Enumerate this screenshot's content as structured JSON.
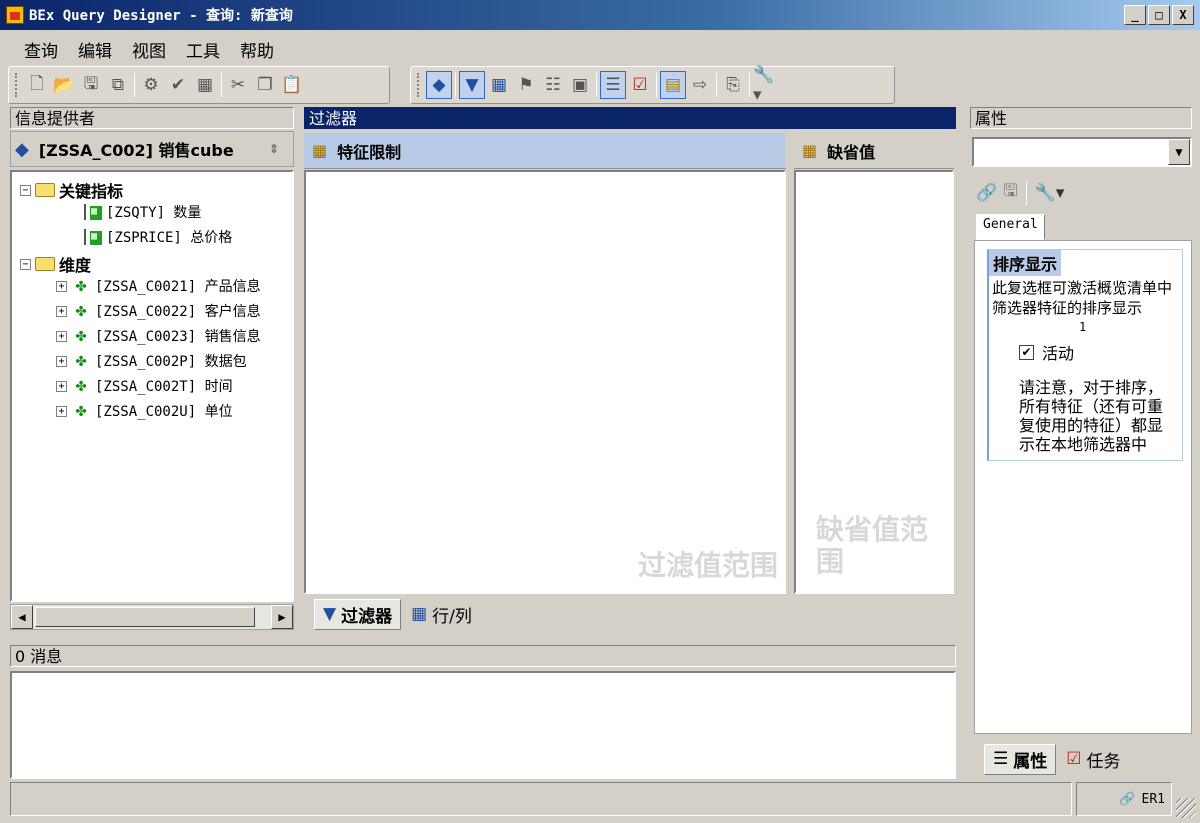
{
  "window": {
    "title": "BEx Query Designer - 查询: 新查询",
    "min": "_",
    "max": "□",
    "close": "X"
  },
  "menu": [
    "查询",
    "编辑",
    "视图",
    "工具",
    "帮助"
  ],
  "left_panel": {
    "header": "信息提供者",
    "provider": "[ZSSA_C002] 销售cube",
    "key_figures_label": "关键指标",
    "key_figures": [
      "[ZSQTY] 数量",
      "[ZSPRICE] 总价格"
    ],
    "dimensions_label": "维度",
    "dimensions": [
      "[ZSSA_C0021] 产品信息",
      "[ZSSA_C0022] 客户信息",
      "[ZSSA_C0023] 销售信息",
      "[ZSSA_C002P] 数据包",
      "[ZSSA_C002T] 时间",
      "[ZSSA_C002U] 单位"
    ]
  },
  "center_panel": {
    "header": "过滤器",
    "char_restrictions": "特征限制",
    "default_values": "缺省值",
    "filter_watermark": "过滤值范围",
    "default_watermark": "缺省值范围",
    "tabs": [
      "过滤器",
      "行/列"
    ]
  },
  "right_panel": {
    "header": "属性",
    "tab": "General",
    "section_title": "排序显示",
    "description": "此复选框可激活概览清单中筛选器特征的排序显示",
    "marker": "1",
    "checkbox_label": "活动",
    "checkbox_checked": true,
    "note": "请注意，对于排序，所有特征（还有可重复使用的特征）都显示在本地筛选器中",
    "bottom_tabs": [
      "属性",
      "任务"
    ]
  },
  "messages": {
    "header": "0 消息"
  },
  "status": {
    "system": "ER1"
  }
}
